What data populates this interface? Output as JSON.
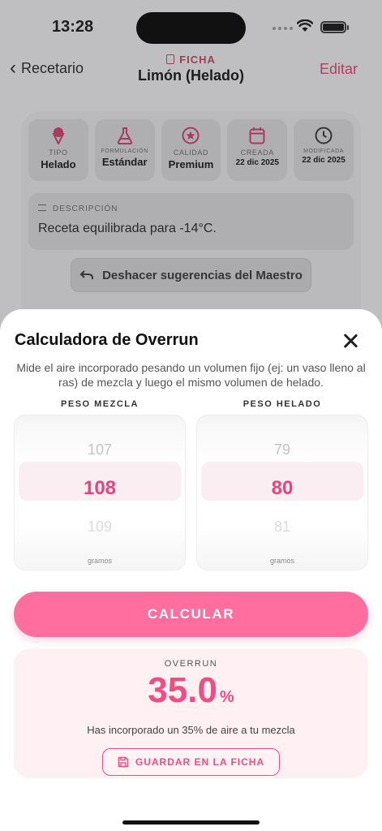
{
  "status_bar": {
    "time": "13:28"
  },
  "nav": {
    "back_label": "Recetario",
    "subtitle": "FICHA",
    "title": "Limón  (Helado)",
    "edit_label": "Editar"
  },
  "meta": [
    {
      "icon": "ice-cream-icon",
      "label": "TIPO",
      "value": "Helado"
    },
    {
      "icon": "flask-icon",
      "label": "FORMULACIÓN",
      "value": "Estándar"
    },
    {
      "icon": "star-badge-icon",
      "label": "CALIDAD",
      "value": "Premium"
    },
    {
      "icon": "calendar-icon",
      "label": "CREADA",
      "value": "22 dic 2025"
    },
    {
      "icon": "clock-icon",
      "label": "MODIFICADA",
      "value": "22 dic 2025"
    }
  ],
  "description": {
    "label": "DESCRIPCIÓN",
    "text": "Receta equilibrada para -14°C."
  },
  "undo_label": "Deshacer sugerencias del Maestro",
  "sheet": {
    "title": "Calculadora de Overrun",
    "description": "Mide el aire incorporado pesando un volumen fijo (ej: un vaso lleno al ras) de mezcla y luego el mismo volumen de helado.",
    "mix_picker": {
      "label": "PESO MEZCLA",
      "prev": "107",
      "value": "108",
      "next": "109",
      "unit": "gramos"
    },
    "ice_picker": {
      "label": "PESO HELADO",
      "prev": "79",
      "value": "80",
      "next": "81",
      "unit": "gramos"
    },
    "calculate_label": "CALCULAR",
    "result": {
      "label": "OVERRUN",
      "value": "35.0",
      "unit": "%",
      "text": "Has incorporado un 35% de aire a tu mezcla",
      "save_label": "GUARDAR EN LA FICHA"
    }
  },
  "colors": {
    "accent": "#ff6e9e",
    "accent_text": "#ef4e82"
  }
}
